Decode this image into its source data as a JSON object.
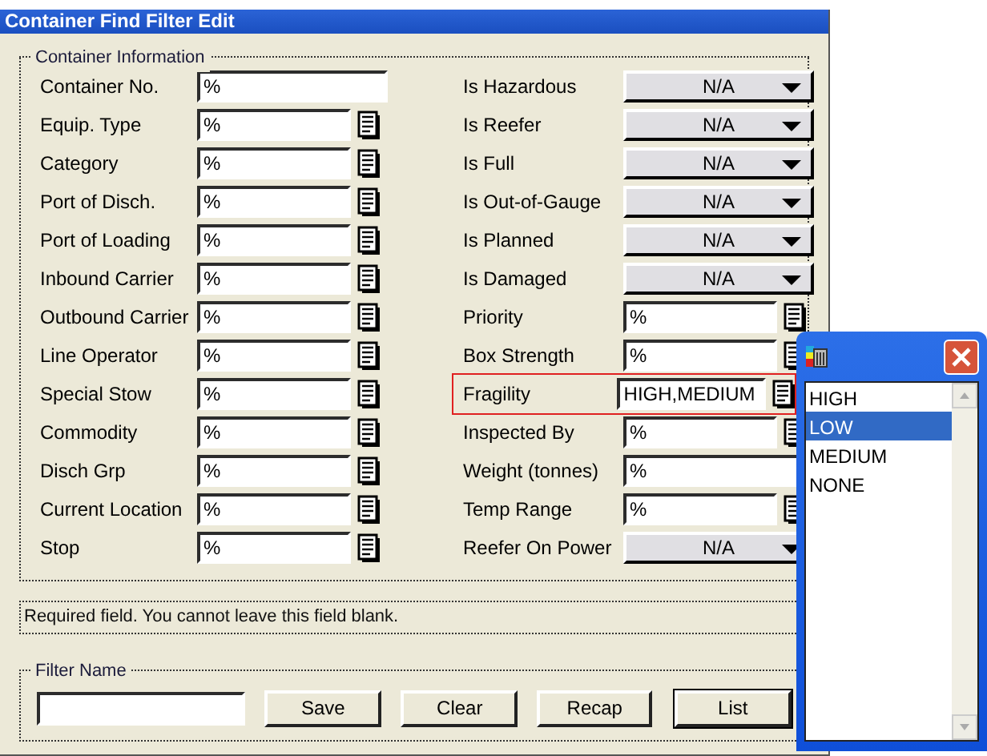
{
  "window": {
    "title": "Container Find Filter Edit"
  },
  "container_information": {
    "title": "Container Information",
    "left_fields": [
      {
        "label": "Container No.",
        "kind": "text",
        "value": "%"
      },
      {
        "label": "Equip. Type",
        "kind": "lookup",
        "value": "%"
      },
      {
        "label": "Category",
        "kind": "lookup",
        "value": "%"
      },
      {
        "label": "Port of Disch.",
        "kind": "lookup",
        "value": "%"
      },
      {
        "label": "Port of Loading",
        "kind": "lookup",
        "value": "%"
      },
      {
        "label": "Inbound Carrier",
        "kind": "lookup",
        "value": "%"
      },
      {
        "label": "Outbound Carrier",
        "kind": "lookup",
        "value": "%"
      },
      {
        "label": "Line Operator",
        "kind": "lookup",
        "value": "%"
      },
      {
        "label": "Special Stow",
        "kind": "lookup",
        "value": "%"
      },
      {
        "label": "Commodity",
        "kind": "lookup",
        "value": "%"
      },
      {
        "label": "Disch Grp",
        "kind": "lookup",
        "value": "%"
      },
      {
        "label": "Current Location",
        "kind": "lookup",
        "value": "%"
      },
      {
        "label": "Stop",
        "kind": "lookup",
        "value": "%"
      }
    ],
    "right_fields": [
      {
        "label": "Is Hazardous",
        "kind": "combo",
        "value": "N/A",
        "highlighted": false
      },
      {
        "label": "Is Reefer",
        "kind": "combo",
        "value": "N/A",
        "highlighted": false
      },
      {
        "label": "Is Full",
        "kind": "combo",
        "value": "N/A",
        "highlighted": false
      },
      {
        "label": "Is Out-of-Gauge",
        "kind": "combo",
        "value": "N/A",
        "highlighted": false
      },
      {
        "label": "Is Planned",
        "kind": "combo",
        "value": "N/A",
        "highlighted": false
      },
      {
        "label": "Is Damaged",
        "kind": "combo",
        "value": "N/A",
        "highlighted": false
      },
      {
        "label": "Priority",
        "kind": "lookup",
        "value": "%",
        "highlighted": false
      },
      {
        "label": "Box Strength",
        "kind": "lookup",
        "value": "%",
        "highlighted": false
      },
      {
        "label": "Fragility",
        "kind": "lookup",
        "value": "HIGH,MEDIUM",
        "highlighted": true
      },
      {
        "label": "Inspected By",
        "kind": "lookup",
        "value": "%",
        "highlighted": false
      },
      {
        "label": "Weight (tonnes)",
        "kind": "text",
        "value": "%",
        "highlighted": false
      },
      {
        "label": "Temp Range",
        "kind": "lookup",
        "value": "%",
        "highlighted": false
      },
      {
        "label": "Reefer On Power",
        "kind": "combo",
        "value": "N/A",
        "highlighted": false
      }
    ]
  },
  "status_message": "Required field. You cannot leave this field blank.",
  "filter_name": {
    "title": "Filter Name"
  },
  "buttons": [
    {
      "label": "Save",
      "default": false
    },
    {
      "label": "Clear",
      "default": false
    },
    {
      "label": "Recap",
      "default": false
    },
    {
      "label": "List",
      "default": true
    }
  ],
  "picker": {
    "items": [
      {
        "label": "HIGH",
        "selected": false
      },
      {
        "label": "LOW",
        "selected": true
      },
      {
        "label": "MEDIUM",
        "selected": false
      },
      {
        "label": "NONE",
        "selected": false
      }
    ]
  }
}
